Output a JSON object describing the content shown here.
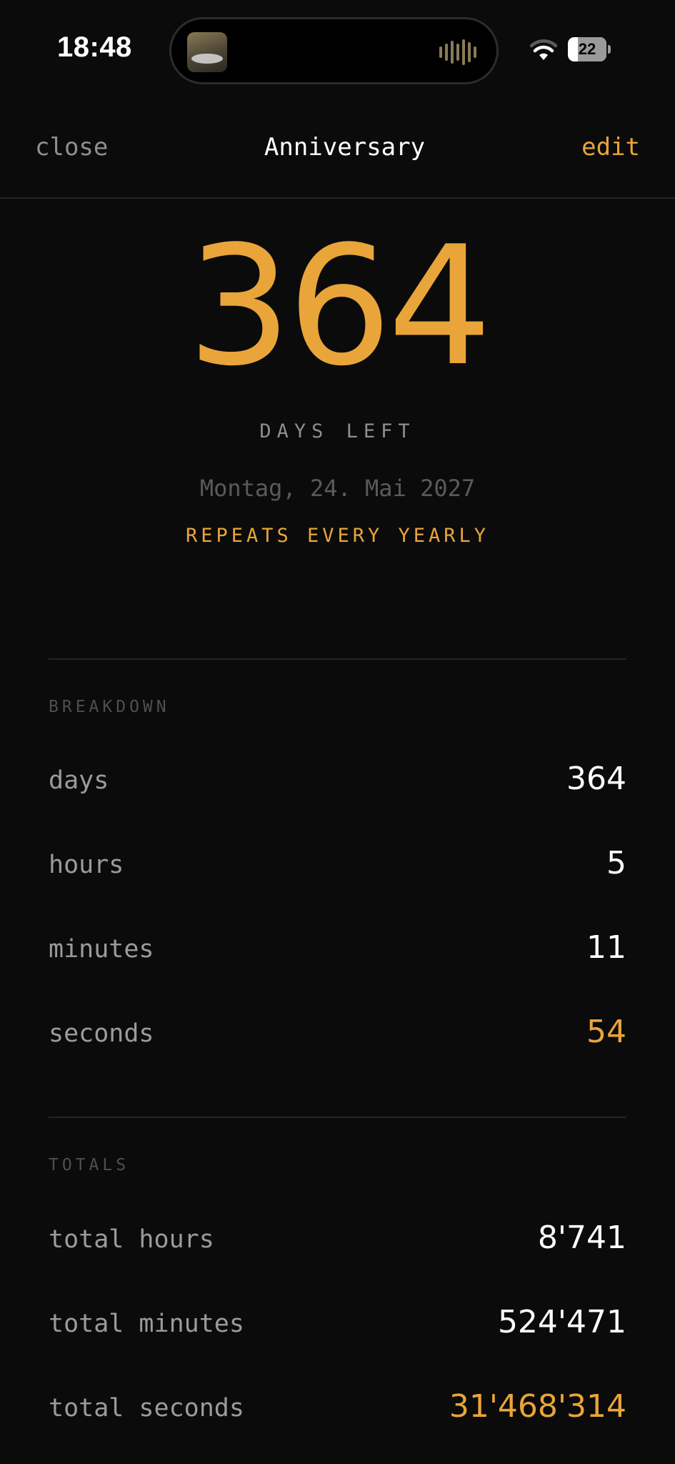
{
  "status_bar": {
    "time": "18:48",
    "battery_level": "22",
    "icons": [
      "album-art-icon",
      "waveform-icon",
      "wifi-icon",
      "battery-icon"
    ]
  },
  "nav": {
    "close_label": "close",
    "title": "Anniversary",
    "edit_label": "edit"
  },
  "hero": {
    "days_left": "364",
    "days_left_label": "DAYS LEFT",
    "target_date": "Montag, 24. Mai 2027",
    "repeat_text": "REPEATS EVERY YEARLY"
  },
  "breakdown": {
    "section_label": "BREAKDOWN",
    "rows": [
      {
        "label": "days",
        "value": "364"
      },
      {
        "label": "hours",
        "value": "5"
      },
      {
        "label": "minutes",
        "value": "11"
      },
      {
        "label": "seconds",
        "value": "54"
      }
    ]
  },
  "totals": {
    "section_label": "TOTALS",
    "rows": [
      {
        "label": "total hours",
        "value": "8'741"
      },
      {
        "label": "total minutes",
        "value": "524'471"
      },
      {
        "label": "total seconds",
        "value": "31'468'314"
      }
    ]
  },
  "colors": {
    "background": "#0b0b0b",
    "accent": "#e9a53a",
    "primary_text": "#ffffff",
    "secondary_text": "#9b9b9b",
    "muted_text": "#5a5a5a"
  }
}
